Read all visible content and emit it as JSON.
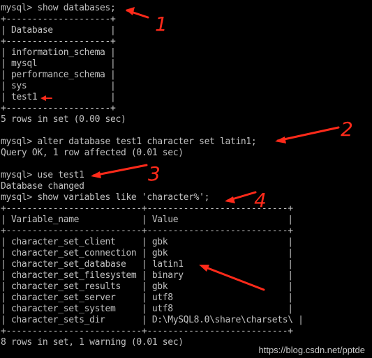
{
  "terminal": {
    "lines": [
      "mysql> show databases;",
      "+--------------------+",
      "| Database           |",
      "+--------------------+",
      "| information_schema |",
      "| mysql              |",
      "| performance_schema |",
      "| sys                |",
      "| test1              |",
      "+--------------------+",
      "5 rows in set (0.00 sec)",
      "",
      "mysql> alter database test1 character set latin1;",
      "Query OK, 1 row affected (0.01 sec)",
      "",
      "mysql> use test1",
      "Database changed",
      "mysql> show variables like 'character%';",
      "+--------------------------+---------------------------+",
      "| Variable_name            | Value                     |",
      "+--------------------------+---------------------------+",
      "| character_set_client     | gbk                       |",
      "| character_set_connection | gbk                       |",
      "| character_set_database   | latin1                    |",
      "| character_set_filesystem | binary                    |",
      "| character_set_results    | gbk                       |",
      "| character_set_server     | utf8                      |",
      "| character_set_system     | utf8                      |",
      "| character_sets_dir       | D:\\MySQL8.0\\share\\charsets\\ |",
      "+--------------------------+---------------------------+",
      "8 rows in set, 1 warning (0.01 sec)"
    ]
  },
  "annotations": {
    "color": "#ff2a1a",
    "labels": [
      "1",
      "2",
      "3",
      "4"
    ]
  },
  "watermark": "https://blog.csdn.net/pptde"
}
